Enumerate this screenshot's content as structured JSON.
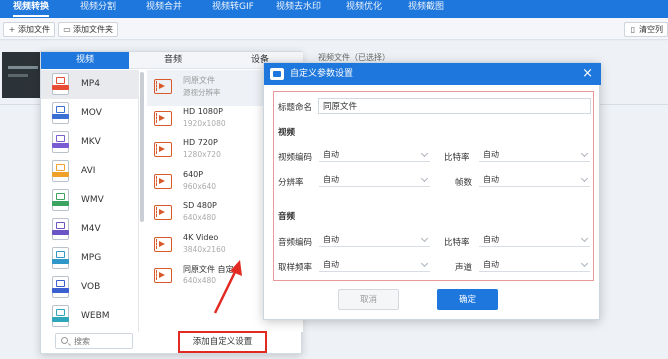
{
  "topnav": {
    "tabs": [
      "视频转换",
      "视频分割",
      "视频合并",
      "视频转GIF",
      "视频去水印",
      "视频优化",
      "视频截图"
    ],
    "active_index": 0,
    "accent": "#1e77dc"
  },
  "toolbar": {
    "add_file": "添加文件",
    "add_folder": "添加文件夹",
    "clear_list": "清空列",
    "add_icon": "plus-icon",
    "folder_icon": "folder-icon",
    "clear_icon": "trash-icon"
  },
  "background": {
    "file_info_text": "视频文件（已选择）"
  },
  "format_panel": {
    "tabs": [
      "视频",
      "音频",
      "设备"
    ],
    "active_tab": 0,
    "formats": [
      {
        "name": "MP4",
        "color": "#e94c35"
      },
      {
        "name": "MOV",
        "color": "#3a6fd4"
      },
      {
        "name": "MKV",
        "color": "#7a5bd1"
      },
      {
        "name": "AVI",
        "color": "#f0a12a"
      },
      {
        "name": "WMV",
        "color": "#3aa35f"
      },
      {
        "name": "M4V",
        "color": "#6b54c6"
      },
      {
        "name": "MPG",
        "color": "#2f98c9"
      },
      {
        "name": "VOB",
        "color": "#3a5fcf"
      },
      {
        "name": "WEBM",
        "color": "#2fa6b9"
      }
    ],
    "active_format": 0,
    "presets": [
      {
        "name": "同原文件",
        "res": "源视分辨率"
      },
      {
        "name": "HD 1080P",
        "res": "1920x1080"
      },
      {
        "name": "HD 720P",
        "res": "1280x720"
      },
      {
        "name": "640P",
        "res": "960x640"
      },
      {
        "name": "SD 480P",
        "res": "640x480"
      },
      {
        "name": "4K Video",
        "res": "3840x2160"
      },
      {
        "name": "同原文件 自定义",
        "res": "640x480"
      }
    ],
    "active_preset": 0,
    "search_placeholder": "搜索",
    "add_custom_label": "添加自定义设置"
  },
  "dialog": {
    "title": "自定义参数设置",
    "title_label": "标题命名",
    "title_value": "同原文件",
    "video_section": "视频",
    "audio_section": "音频",
    "video_codec_label": "视频编码",
    "video_codec_value": "自动",
    "bitrate_label": "比特率",
    "bitrate_value": "自动",
    "resolution_label": "分辨率",
    "resolution_value": "自动",
    "framerate_label": "帧数",
    "framerate_value": "自动",
    "audio_codec_label": "音频编码",
    "audio_codec_value": "自动",
    "audio_bitrate_label": "比特率",
    "audio_bitrate_value": "自动",
    "samplerate_label": "取样频率",
    "samplerate_value": "自动",
    "channel_label": "声道",
    "channel_value": "自动",
    "cancel_label": "取消",
    "ok_label": "确定",
    "close_glyph": "×"
  }
}
